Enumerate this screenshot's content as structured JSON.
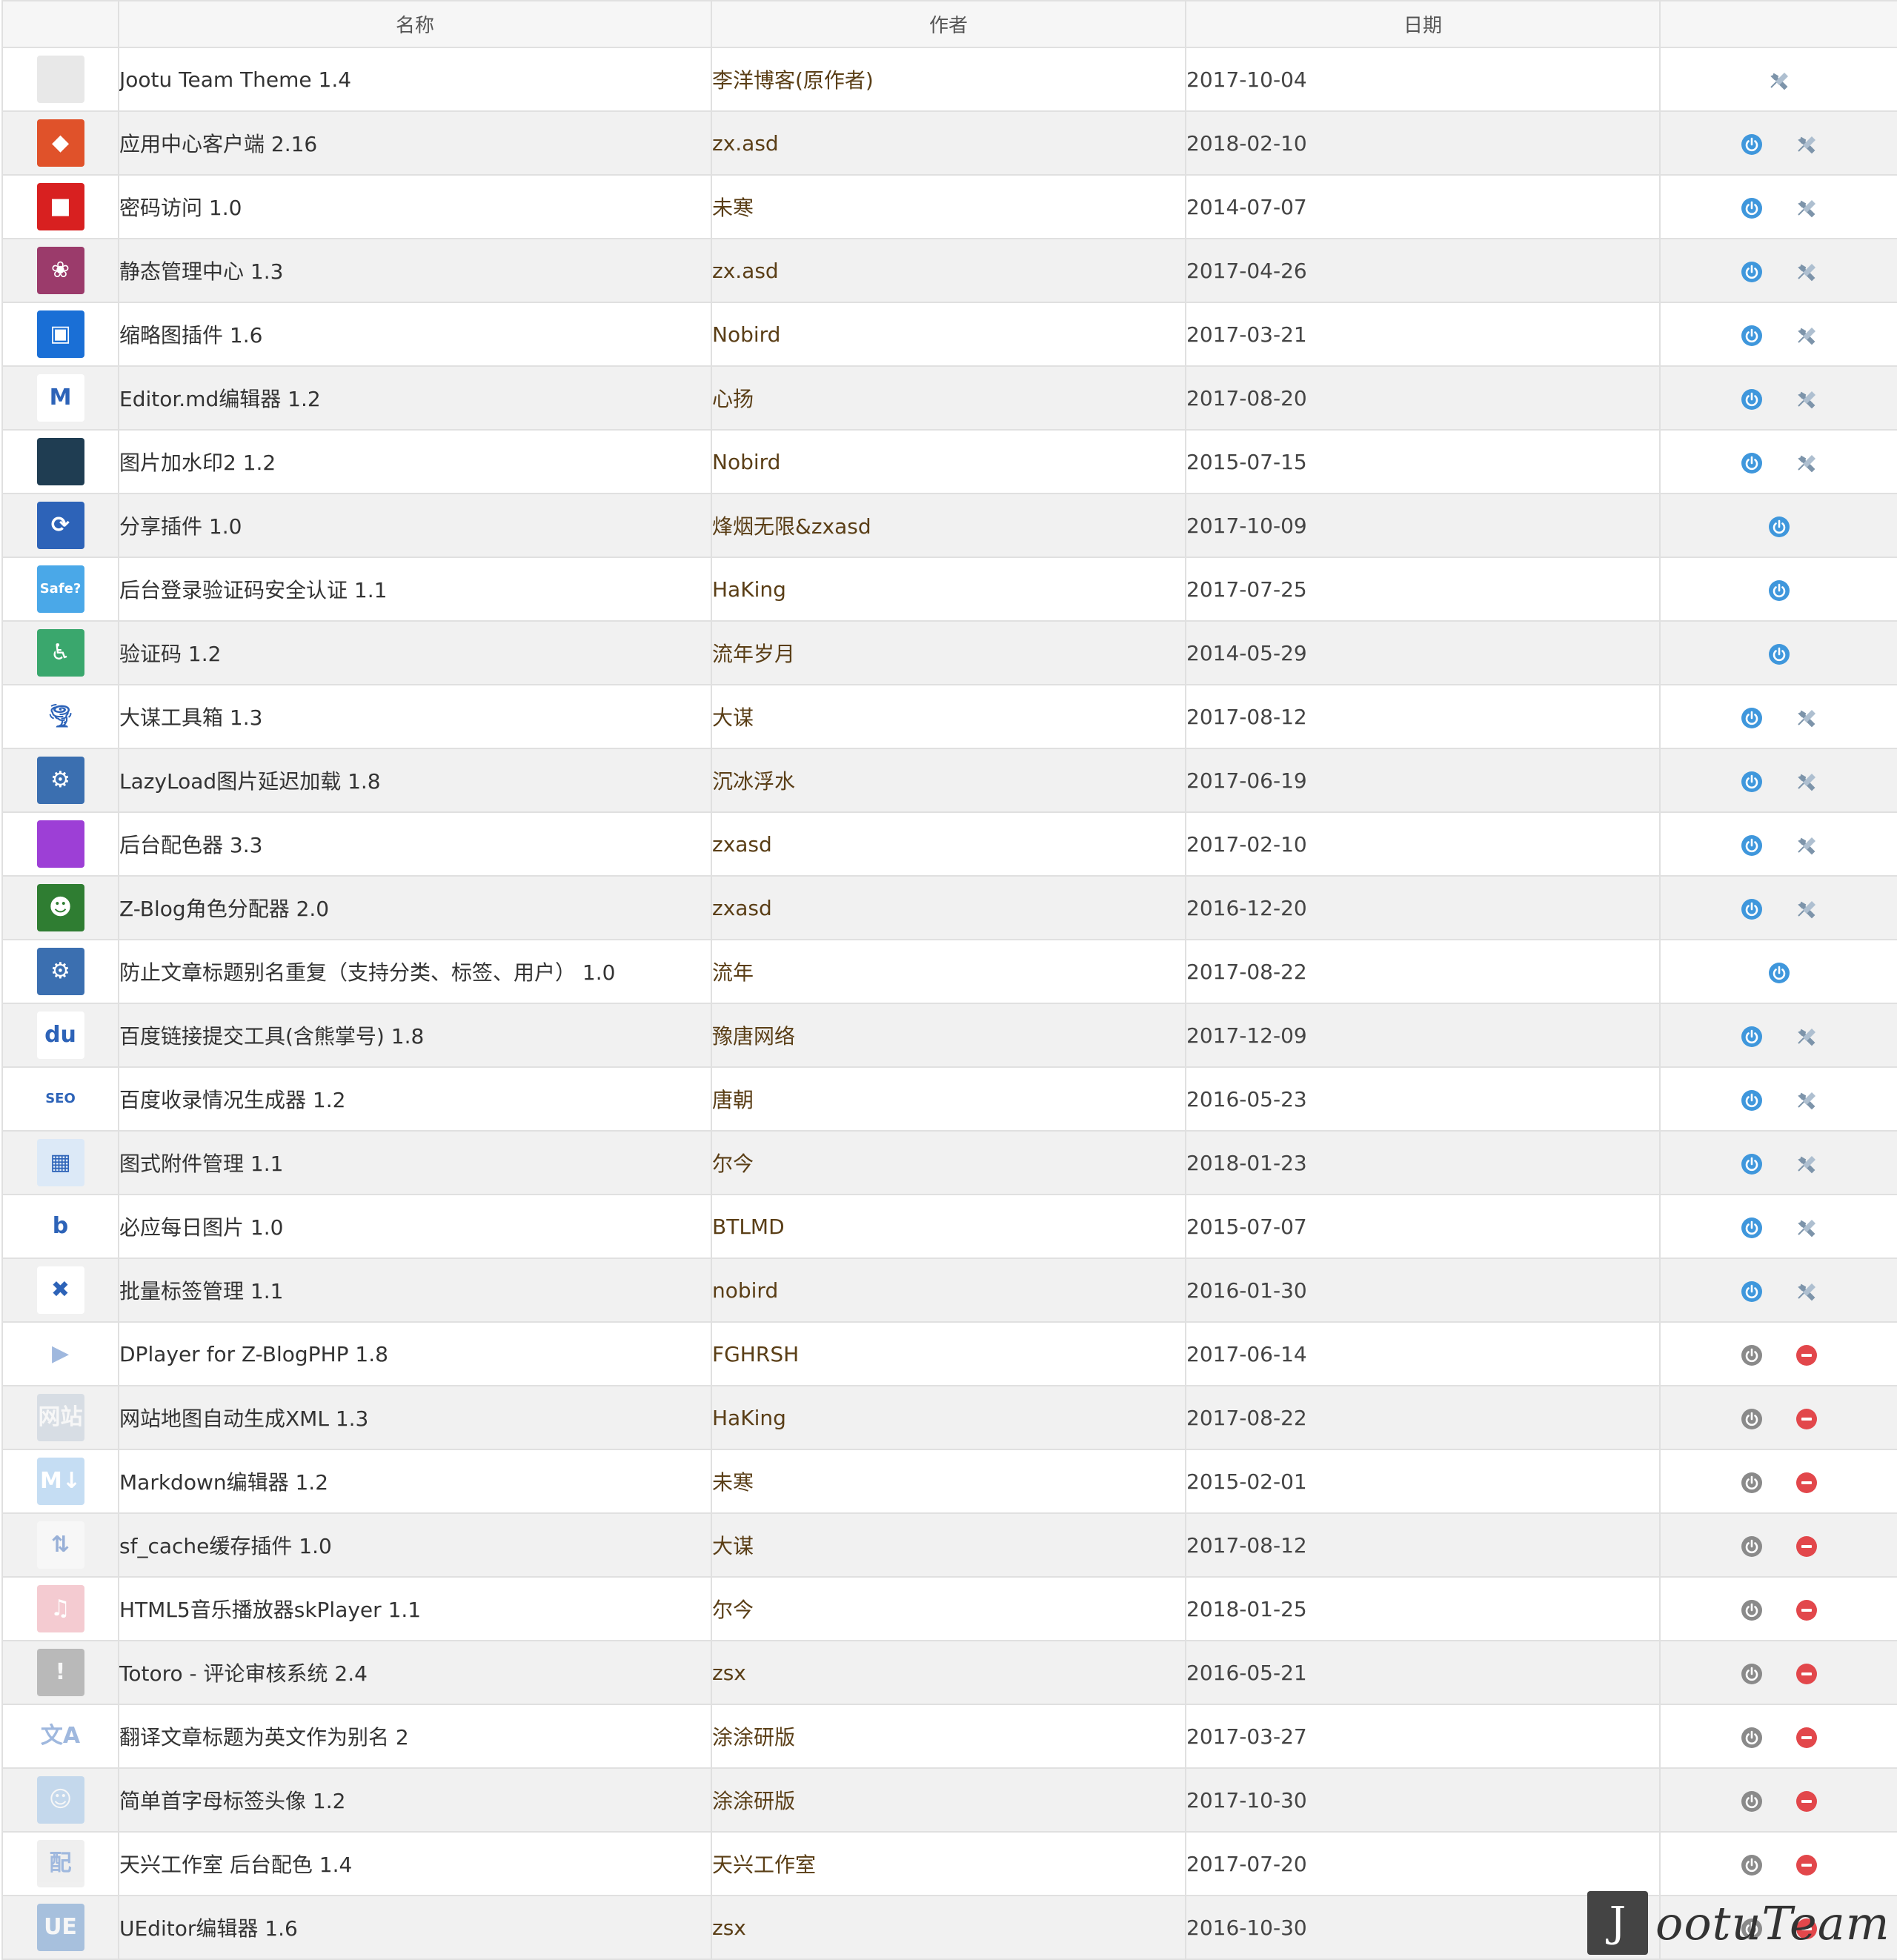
{
  "table": {
    "headers": {
      "icon": "",
      "name": "名称",
      "author": "作者",
      "date": "日期",
      "actions": ""
    },
    "rows": [
      {
        "name": "Jootu Team Theme 1.4",
        "author": "李洋博客(原作者)",
        "date": "2017-10-04",
        "icon": "theme-screenshot-icon",
        "icon_color": "#e8e8e8",
        "icon_text": "",
        "enabled": true,
        "actions": [
          "settings"
        ]
      },
      {
        "name": "应用中心客户端 2.16",
        "author": "zx.asd",
        "date": "2018-02-10",
        "icon": "app-center-box-icon",
        "icon_color": "#e0522a",
        "icon_text": "◆",
        "enabled": true,
        "actions": [
          "power",
          "settings"
        ]
      },
      {
        "name": "密码访问 1.0",
        "author": "未寒",
        "date": "2014-07-07",
        "icon": "lock-icon",
        "icon_color": "#d82020",
        "icon_text": "■",
        "enabled": true,
        "actions": [
          "power",
          "settings"
        ]
      },
      {
        "name": "静态管理中心 1.3",
        "author": "zx.asd",
        "date": "2017-04-26",
        "icon": "hexagon-cluster-icon",
        "icon_color": "#9b3b6b",
        "icon_text": "❀",
        "enabled": true,
        "actions": [
          "power",
          "settings"
        ]
      },
      {
        "name": "缩略图插件 1.6",
        "author": "Nobird",
        "date": "2017-03-21",
        "icon": "image-thumbnail-icon",
        "icon_color": "#1a6fd6",
        "icon_text": "▣",
        "enabled": true,
        "actions": [
          "power",
          "settings"
        ]
      },
      {
        "name": "Editor.md编辑器 1.2",
        "author": "心扬",
        "date": "2017-08-20",
        "icon": "editor-md-icon",
        "icon_color": "#ffffff",
        "icon_text": "M",
        "enabled": true,
        "actions": [
          "power",
          "settings"
        ]
      },
      {
        "name": "图片加水印2 1.2",
        "author": "Nobird",
        "date": "2015-07-15",
        "icon": "watermark-photo-icon",
        "icon_color": "#1f3d52",
        "icon_text": "",
        "enabled": true,
        "actions": [
          "power",
          "settings"
        ]
      },
      {
        "name": "分享插件 1.0",
        "author": "烽烟无限&zxasd",
        "date": "2017-10-09",
        "icon": "share-nodes-icon",
        "icon_color": "#2d63b8",
        "icon_text": "⟳",
        "enabled": true,
        "actions": [
          "power"
        ]
      },
      {
        "name": "后台登录验证码安全认证 1.1",
        "author": "HaKing",
        "date": "2017-07-25",
        "icon": "are-you-safe-icon",
        "icon_color": "#4aa8e8",
        "icon_text": "Safe?",
        "enabled": true,
        "actions": [
          "power"
        ]
      },
      {
        "name": "验证码 1.2",
        "author": "流年岁月",
        "date": "2014-05-29",
        "icon": "accessibility-icon",
        "icon_color": "#3aa76d",
        "icon_text": "♿",
        "enabled": true,
        "actions": [
          "power"
        ]
      },
      {
        "name": "大谋工具箱 1.3",
        "author": "大谋",
        "date": "2017-08-12",
        "icon": "tornado-icon",
        "icon_color": "#ffffff",
        "icon_text": "🌪",
        "enabled": true,
        "actions": [
          "power",
          "settings"
        ]
      },
      {
        "name": "LazyLoad图片延迟加载 1.8",
        "author": "沉冰浮水",
        "date": "2017-06-19",
        "icon": "gears-icon",
        "icon_color": "#3b6fb0",
        "icon_text": "⚙",
        "enabled": true,
        "actions": [
          "power",
          "settings"
        ]
      },
      {
        "name": "后台配色器 3.3",
        "author": "zxasd",
        "date": "2017-02-10",
        "icon": "color-mosaic-icon",
        "icon_color": "#9d3fd6",
        "icon_text": "",
        "enabled": true,
        "actions": [
          "power",
          "settings"
        ]
      },
      {
        "name": "Z-Blog角色分配器 2.0",
        "author": "zxasd",
        "date": "2016-12-20",
        "icon": "devil-face-icon",
        "icon_color": "#2f7d32",
        "icon_text": "☻",
        "enabled": true,
        "actions": [
          "power",
          "settings"
        ]
      },
      {
        "name": "防止文章标题别名重复（支持分类、标签、用户） 1.0",
        "author": "流年",
        "date": "2017-08-22",
        "icon": "gears-icon",
        "icon_color": "#3b6fb0",
        "icon_text": "⚙",
        "enabled": true,
        "actions": [
          "power"
        ]
      },
      {
        "name": "百度链接提交工具(含熊掌号) 1.8",
        "author": "豫唐网络",
        "date": "2017-12-09",
        "icon": "baidu-paw-icon",
        "icon_color": "#ffffff",
        "icon_text": "du",
        "enabled": true,
        "actions": [
          "power",
          "settings"
        ]
      },
      {
        "name": "百度收录情况生成器 1.2",
        "author": "唐朝",
        "date": "2016-05-23",
        "icon": "seo-badge-icon",
        "icon_color": "#ffffff",
        "icon_text": "SEO",
        "enabled": true,
        "actions": [
          "power",
          "settings"
        ]
      },
      {
        "name": "图式附件管理 1.1",
        "author": "尔今",
        "date": "2018-01-23",
        "icon": "attachment-grid-icon",
        "icon_color": "#dce9f7",
        "icon_text": "▦",
        "enabled": true,
        "actions": [
          "power",
          "settings"
        ]
      },
      {
        "name": "必应每日图片 1.0",
        "author": "BTLMD",
        "date": "2015-07-07",
        "icon": "bing-logo-icon",
        "icon_color": "#ffffff",
        "icon_text": "b",
        "enabled": true,
        "actions": [
          "power",
          "settings"
        ]
      },
      {
        "name": "批量标签管理 1.1",
        "author": "nobird",
        "date": "2016-01-30",
        "icon": "wrench-screwdriver-icon",
        "icon_color": "#ffffff",
        "icon_text": "✖",
        "enabled": true,
        "actions": [
          "power",
          "settings"
        ]
      },
      {
        "name": "DPlayer for Z-BlogPHP 1.8",
        "author": "FGHRSH",
        "date": "2017-06-14",
        "icon": "play-circle-icon",
        "icon_color": "#ffffff",
        "icon_text": "▶",
        "enabled": false,
        "actions": [
          "power",
          "delete"
        ]
      },
      {
        "name": "网站地图自动生成XML 1.3",
        "author": "HaKing",
        "date": "2017-08-22",
        "icon": "sitemap-text-icon",
        "icon_color": "#b9c7d6",
        "icon_text": "网站",
        "enabled": false,
        "actions": [
          "power",
          "delete"
        ]
      },
      {
        "name": "Markdown编辑器 1.2",
        "author": "未寒",
        "date": "2015-02-01",
        "icon": "markdown-circle-icon",
        "icon_color": "#7fb4e6",
        "icon_text": "M↓",
        "enabled": false,
        "actions": [
          "power",
          "delete"
        ]
      },
      {
        "name": "sf_cache缓存插件 1.0",
        "author": "大谋",
        "date": "2017-08-12",
        "icon": "download-upload-icon",
        "icon_color": "#ffffff",
        "icon_text": "⇅",
        "enabled": false,
        "actions": [
          "power",
          "delete"
        ]
      },
      {
        "name": "HTML5音乐播放器skPlayer 1.1",
        "author": "尔今",
        "date": "2018-01-25",
        "icon": "music-note-icon",
        "icon_color": "#e88d9b",
        "icon_text": "♫",
        "enabled": false,
        "actions": [
          "power",
          "delete"
        ]
      },
      {
        "name": "Totoro - 评论审核系统 2.4",
        "author": "zsx",
        "date": "2016-05-21",
        "icon": "shield-alert-icon",
        "icon_color": "#777777",
        "icon_text": "!",
        "enabled": false,
        "actions": [
          "power",
          "delete"
        ]
      },
      {
        "name": "翻译文章标题为英文作为别名 2",
        "author": "涂涂研版",
        "date": "2017-03-27",
        "icon": "translate-icon",
        "icon_color": "#ffffff",
        "icon_text": "文A",
        "enabled": false,
        "actions": [
          "power",
          "delete"
        ]
      },
      {
        "name": "简单首字母标签头像 1.2",
        "author": "涂涂研版",
        "date": "2017-10-30",
        "icon": "letter-avatar-icon",
        "icon_color": "#8fbce6",
        "icon_text": "☺",
        "enabled": false,
        "actions": [
          "power",
          "delete"
        ]
      },
      {
        "name": "天兴工作室 后台配色 1.4",
        "author": "天兴工作室",
        "date": "2017-07-20",
        "icon": "backend-color-icon",
        "icon_color": "#dddddd",
        "icon_text": "配",
        "enabled": false,
        "actions": [
          "power",
          "delete"
        ]
      },
      {
        "name": "UEditor编辑器 1.6",
        "author": "zsx",
        "date": "2016-10-30",
        "icon": "ueditor-icon",
        "icon_color": "#4f86c6",
        "icon_text": "UE",
        "enabled": false,
        "actions": [
          "power",
          "delete"
        ]
      }
    ]
  },
  "watermark": {
    "letter": "J",
    "text": "ootuTeam"
  },
  "colors": {
    "power_enabled": "#3f97dc",
    "power_disabled": "#8a8a8a",
    "settings": "#7d94aa",
    "delete": "#e2474b",
    "row_alt": "#f1f1f1",
    "border": "#e0e0e0"
  }
}
